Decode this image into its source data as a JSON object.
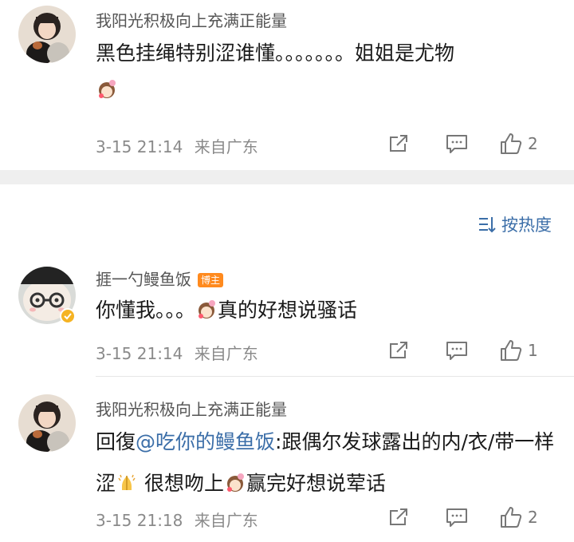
{
  "comments": [
    {
      "username": "我阳光积极向上充满正能量",
      "text": "黑色挂绳特别涩谁懂。。。。。。。姐姐是尤物",
      "date": "3-15 21:14",
      "location": "来自广东",
      "likes": "2",
      "avatar_icon": "girl-with-dog-avatar"
    },
    {
      "username": "捱一勺鳗鱼饭",
      "badge": "博主",
      "text_before": "你懂我。。。",
      "text_after": "真的好想说骚话",
      "date": "3-15 21:14",
      "location": "来自广东",
      "likes": "1",
      "avatar_icon": "cartoon-face-avatar"
    },
    {
      "username": "我阳光积极向上充满正能量",
      "reply_prefix": "回復",
      "mention": "@吃你的鳗鱼饭",
      "text_part1": ":跟偶尔发球露出的内/衣/带一样涩",
      "text_part2": " 很想吻上",
      "text_part3": "赢完好想说荤话",
      "date": "3-15 21:18",
      "location": "来自广东",
      "likes": "2",
      "avatar_icon": "girl-with-dog-avatar"
    }
  ],
  "sort": {
    "label": "按热度",
    "icon": "sort-icon"
  },
  "colors": {
    "link": "#3b6ea8",
    "badge": "#ff8a1e",
    "meta": "#8a8a8a"
  }
}
